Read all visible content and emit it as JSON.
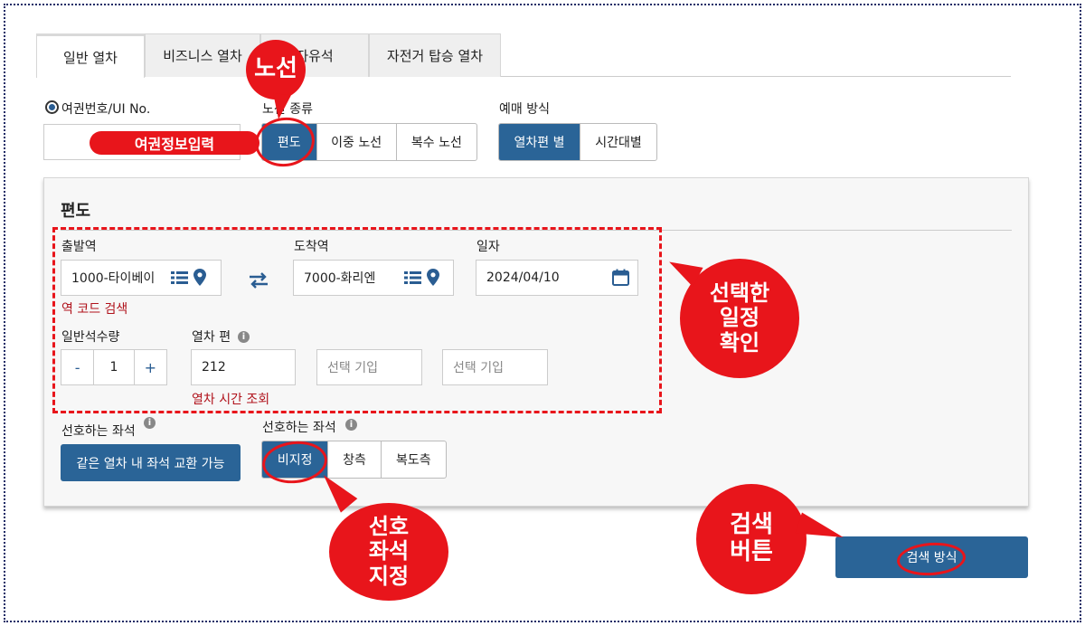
{
  "tabs": [
    "일반 열차",
    "비즈니스 열차",
    "자유석",
    "자전거 탑승 열차"
  ],
  "id_type": {
    "label": "여권번호/UI No.",
    "button": "여권정보입력"
  },
  "route_type": {
    "label": "노선 종류",
    "options": [
      "편도",
      "이중 노선",
      "복수 노선"
    ],
    "selected": "편도"
  },
  "booking_method": {
    "label": "예매 방식",
    "options": [
      "열차편 별",
      "시간대별"
    ],
    "selected": "열차편 별"
  },
  "panel": {
    "title": "편도",
    "departure": {
      "label": "출발역",
      "value": "1000-타이베이",
      "note": "역 코드 검색"
    },
    "arrival": {
      "label": "도착역",
      "value": "7000-화리엔"
    },
    "date": {
      "label": "일자",
      "value": "2024/04/10"
    },
    "quantity": {
      "label": "일반석수량",
      "minus": "-",
      "value": "1",
      "plus": "+"
    },
    "train": {
      "label": "열차 편",
      "value": "212",
      "placeholder1": "선택 기입",
      "placeholder2": "선택 기입",
      "note": "열차 시간 조회"
    },
    "pref_seat_left": {
      "label": "선호하는 좌석",
      "button": "같은 열차 내 좌석 교환 가능"
    },
    "pref_seat_right": {
      "label": "선호하는 좌석",
      "options": [
        "비지정",
        "창측",
        "복도측"
      ],
      "selected": "비지정"
    }
  },
  "search_button": "검색 방식",
  "annotations": {
    "route": "노선",
    "schedule": [
      "선택한",
      "일정",
      "확인"
    ],
    "seat": [
      "선호",
      "좌석",
      "지정"
    ],
    "search": [
      "검색",
      "버튼"
    ]
  },
  "colors": {
    "primary": "#2a6497",
    "annotation_red": "#e8151b",
    "note_red": "#b0121b",
    "frame": "#1e2a66"
  }
}
